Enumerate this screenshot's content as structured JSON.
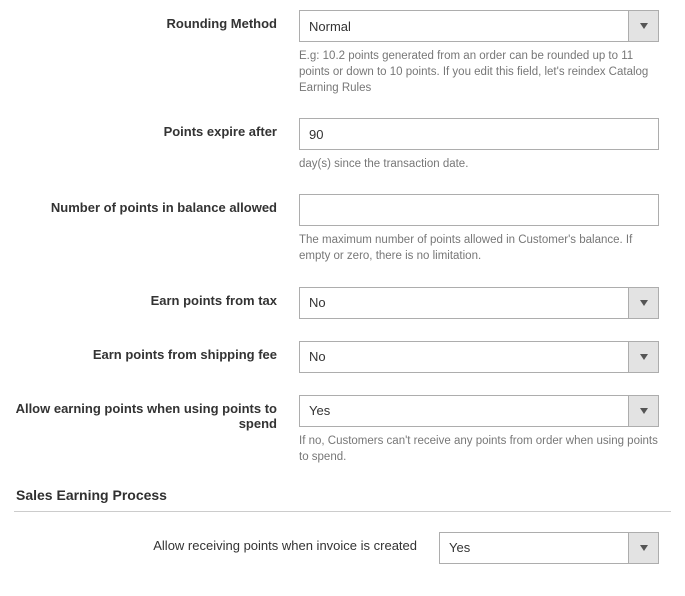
{
  "fields": {
    "rounding": {
      "label": "Rounding Method",
      "value": "Normal",
      "note": "E.g: 10.2 points generated from an order can be rounded up to 11 points or down to 10 points. If you edit this field, let's reindex Catalog Earning Rules"
    },
    "expire": {
      "label": "Points expire after",
      "value": "90",
      "note": "day(s) since the transaction date."
    },
    "balance": {
      "label": "Number of points in balance allowed",
      "value": "",
      "note": "The maximum number of points allowed in Customer's balance. If empty or zero, there is no limitation."
    },
    "tax": {
      "label": "Earn points from tax",
      "value": "No"
    },
    "shipping": {
      "label": "Earn points from shipping fee",
      "value": "No"
    },
    "spend": {
      "label": "Allow earning points when using points to spend",
      "value": "Yes",
      "note": "If no, Customers can't receive any points from order when using points to spend."
    }
  },
  "section": {
    "heading": "Sales Earning Process",
    "invoice": {
      "label": "Allow receiving points when invoice is created",
      "value": "Yes"
    }
  }
}
